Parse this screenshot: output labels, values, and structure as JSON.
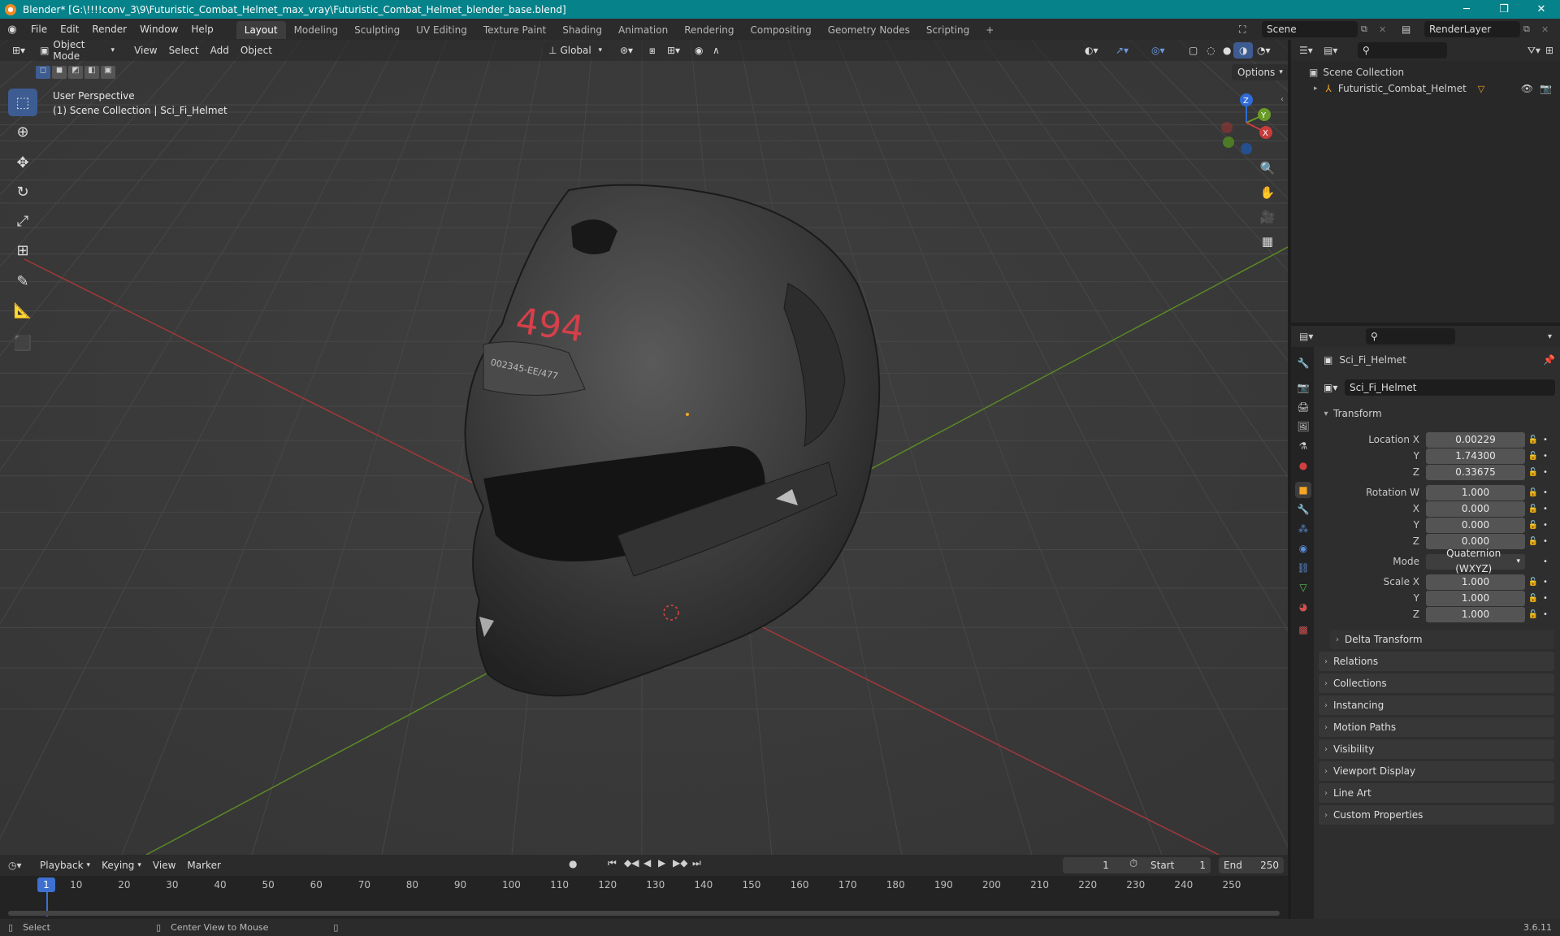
{
  "window": {
    "title": "Blender* [G:\\!!!!conv_3\\9\\Futuristic_Combat_Helmet_max_vray\\Futuristic_Combat_Helmet_blender_base.blend]"
  },
  "menu": [
    "File",
    "Edit",
    "Render",
    "Window",
    "Help"
  ],
  "workspaces": [
    "Layout",
    "Modeling",
    "Sculpting",
    "UV Editing",
    "Texture Paint",
    "Shading",
    "Animation",
    "Rendering",
    "Compositing",
    "Geometry Nodes",
    "Scripting"
  ],
  "active_workspace": "Layout",
  "scene": {
    "name": "Scene",
    "render_layer": "RenderLayer"
  },
  "viewport": {
    "mode": "Object Mode",
    "menus": [
      "View",
      "Select",
      "Add",
      "Object"
    ],
    "orientation": "Global",
    "options_label": "Options",
    "info_line1": "User Perspective",
    "info_line2": "(1) Scene Collection | Sci_Fi_Helmet",
    "helmet_number": "494",
    "helmet_plate": "002345-EE/477",
    "gizmo": {
      "x": "X",
      "y": "Y",
      "z": "Z"
    }
  },
  "outliner": {
    "root": "Scene Collection",
    "items": [
      {
        "name": "Futuristic_Combat_Helmet"
      }
    ]
  },
  "properties": {
    "object_name": "Sci_Fi_Helmet",
    "datablock_name": "Sci_Fi_Helmet",
    "transform_label": "Transform",
    "location": {
      "label_x": "Location X",
      "label_y": "Y",
      "label_z": "Z",
      "x": "0.00229",
      "y": "1.74300",
      "z": "0.33675"
    },
    "rotation": {
      "label_w": "Rotation W",
      "label_x": "X",
      "label_y": "Y",
      "label_z": "Z",
      "w": "1.000",
      "x": "0.000",
      "y": "0.000",
      "z": "0.000"
    },
    "mode_label": "Mode",
    "mode_value": "Quaternion (WXYZ)",
    "scale": {
      "label_x": "Scale X",
      "label_y": "Y",
      "label_z": "Z",
      "x": "1.000",
      "y": "1.000",
      "z": "1.000"
    },
    "delta_transform": "Delta Transform",
    "panels": [
      "Relations",
      "Collections",
      "Instancing",
      "Motion Paths",
      "Visibility",
      "Viewport Display",
      "Line Art",
      "Custom Properties"
    ]
  },
  "timeline": {
    "menus": [
      "Playback",
      "Keying",
      "View",
      "Marker"
    ],
    "current_frame": "1",
    "start_label": "Start",
    "start": "1",
    "end_label": "End",
    "end": "250",
    "ticks": [
      "10",
      "20",
      "30",
      "40",
      "50",
      "60",
      "70",
      "80",
      "90",
      "100",
      "110",
      "120",
      "130",
      "140",
      "150",
      "160",
      "170",
      "180",
      "190",
      "200",
      "210",
      "220",
      "230",
      "240",
      "250"
    ],
    "playhead": "1"
  },
  "status": {
    "left": "Select",
    "middle": "Center View to Mouse",
    "version": "3.6.11"
  },
  "colors": {
    "titlebar": "#06828a",
    "accent": "#3d5c92",
    "x_axis": "#c83c3c",
    "y_axis": "#6a9a28",
    "z_axis": "#2e6bd6",
    "helmet_number": "#d4404a"
  }
}
